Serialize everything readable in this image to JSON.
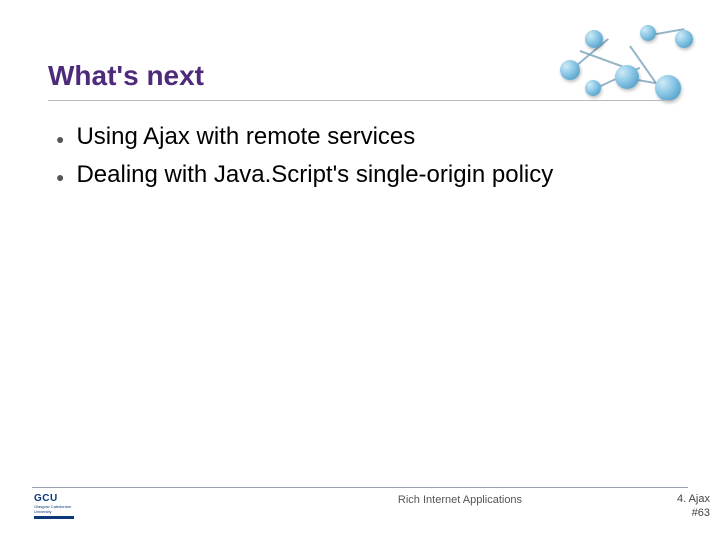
{
  "title": "What's next",
  "bullets": [
    "Using Ajax with remote services",
    "Dealing with Java.Script's single-origin policy"
  ],
  "footer": {
    "logo_text": "GCU",
    "logo_sub": "Glasgow Caledonian University",
    "center": "Rich Internet Applications",
    "right_line1": "4. Ajax",
    "right_line2": "#63"
  }
}
